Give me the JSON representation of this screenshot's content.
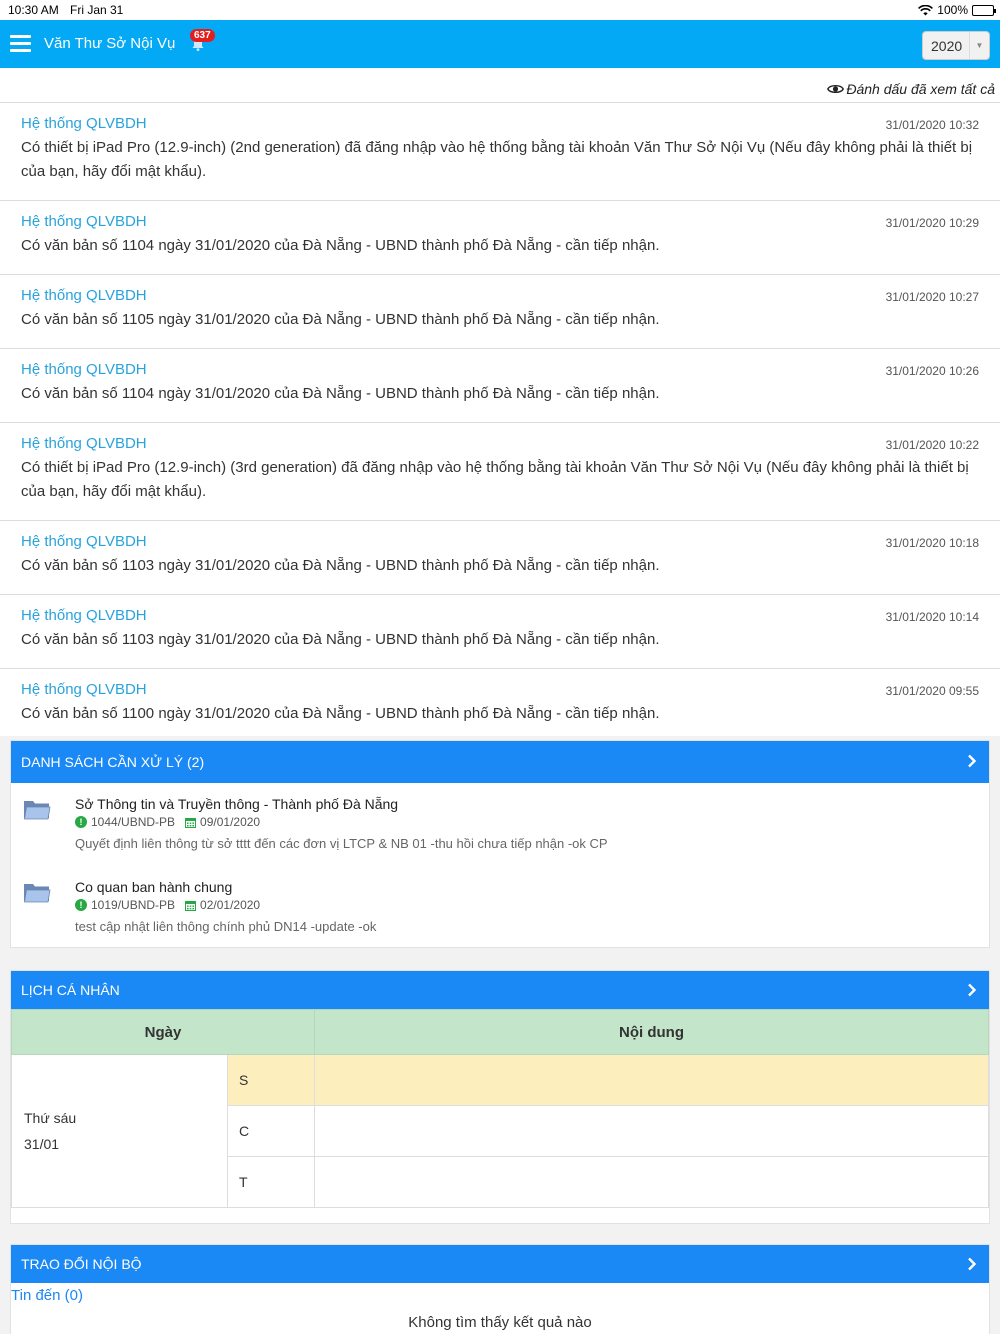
{
  "status_bar": {
    "time": "10:30 AM",
    "date": "Fri Jan 31",
    "battery": "100%"
  },
  "header": {
    "title": "Văn Thư Sở Nội Vụ",
    "badge": "637",
    "year": "2020"
  },
  "mark_all_label": "Đánh dấu đã xem tất cả",
  "notifications": [
    {
      "sender": "Hệ thống QLVBDH",
      "time": "31/01/2020 10:32",
      "message": "Có thiết bị iPad Pro (12.9-inch) (2nd generation) đã đăng nhập vào hệ thống bằng tài khoản Văn Thư Sở Nội Vụ (Nếu đây không phải là thiết bị của bạn, hãy đổi mật khẩu)."
    },
    {
      "sender": "Hệ thống QLVBDH",
      "time": "31/01/2020 10:29",
      "message": "Có văn bản số 1104 ngày 31/01/2020 của Đà Nẵng - UBND thành phố Đà Nẵng - cần tiếp nhận."
    },
    {
      "sender": "Hệ thống QLVBDH",
      "time": "31/01/2020 10:27",
      "message": "Có văn bản số 1105 ngày 31/01/2020 của Đà Nẵng - UBND thành phố Đà Nẵng - cần tiếp nhận."
    },
    {
      "sender": "Hệ thống QLVBDH",
      "time": "31/01/2020 10:26",
      "message": "Có văn bản số 1104 ngày 31/01/2020 của Đà Nẵng - UBND thành phố Đà Nẵng - cần tiếp nhận."
    },
    {
      "sender": "Hệ thống QLVBDH",
      "time": "31/01/2020 10:22",
      "message": "Có thiết bị iPad Pro (12.9-inch) (3rd generation) đã đăng nhập vào hệ thống bằng tài khoản Văn Thư Sở Nội Vụ (Nếu đây không phải là thiết bị của bạn, hãy đổi mật khẩu)."
    },
    {
      "sender": "Hệ thống QLVBDH",
      "time": "31/01/2020 10:18",
      "message": "Có văn bản số 1103 ngày 31/01/2020 của Đà Nẵng - UBND thành phố Đà Nẵng - cần tiếp nhận."
    },
    {
      "sender": "Hệ thống QLVBDH",
      "time": "31/01/2020 10:14",
      "message": "Có văn bản số 1103 ngày 31/01/2020 của Đà Nẵng - UBND thành phố Đà Nẵng - cần tiếp nhận."
    },
    {
      "sender": "Hệ thống QLVBDH",
      "time": "31/01/2020 09:55",
      "message": "Có văn bản số 1100 ngày 31/01/2020 của Đà Nẵng - UBND thành phố Đà Nẵng - cần tiếp nhận."
    }
  ],
  "tasks_panel": {
    "title": "DANH SÁCH CẦN XỬ LÝ (2)",
    "items": [
      {
        "org": "Sở Thông tin và Truyền thông - Thành phố Đà Nẵng",
        "code": "1044/UBND-PB",
        "date": "09/01/2020",
        "desc": "Quyết định liên thông từ sở tttt đến các đơn vị LTCP & NB 01 -thu hồi chưa tiếp nhận -ok CP"
      },
      {
        "org": "Co quan ban hành chung",
        "code": "1019/UBND-PB",
        "date": "02/01/2020",
        "desc": "test cập nhật liên thông chính phủ DN14 -update -ok"
      }
    ]
  },
  "schedule_panel": {
    "title": "LỊCH CÁ NHÂN",
    "col_day": "Ngày",
    "col_content": "Nội dung",
    "day_name": "Thứ sáu",
    "day_date": "31/01",
    "slots": [
      "S",
      "C",
      "T"
    ]
  },
  "internal_panel": {
    "title": "TRAO ĐỔI NỘI BỘ",
    "inbox_label": "Tin đến (0)",
    "empty_text": "Không tìm thấy kết quả nào"
  }
}
